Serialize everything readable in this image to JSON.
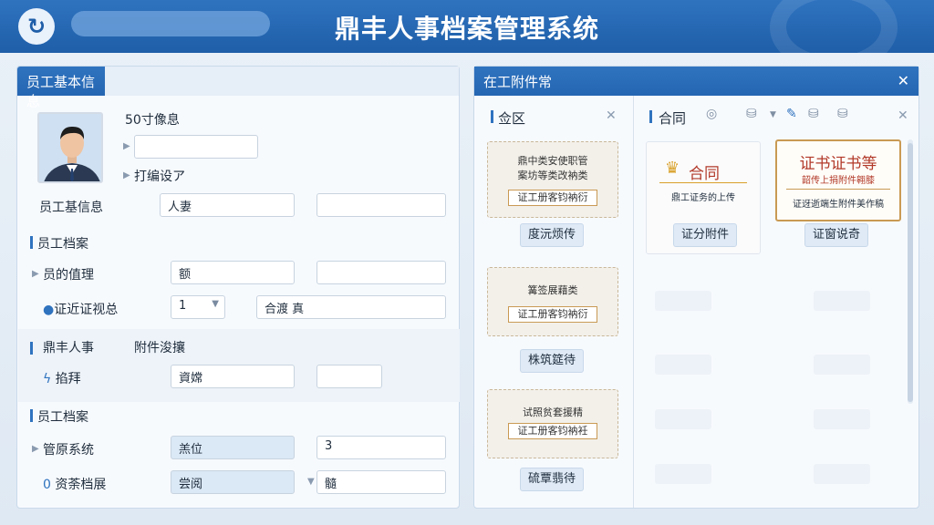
{
  "header": {
    "title": "鼎丰人事档案管理系统",
    "logo_glyph": "↻"
  },
  "left_panel": {
    "tab_title": "员工基本信息",
    "photo_label": "50寸像息",
    "link_label": "打编设ア",
    "row_basic": {
      "label": "员工基信息",
      "value1": "人妻",
      "value2": ""
    },
    "section1": "员工档案",
    "row_a": {
      "label": "员的值理",
      "value1": "额",
      "value2": ""
    },
    "row_b": {
      "label": "证近证视总",
      "select_value": "1",
      "value2": "合渡 真"
    },
    "section2_left": "鼎丰人事",
    "section2_right": "附件浚攘",
    "row_c": {
      "label": "掐拜",
      "value1": "資嫦",
      "value2": ""
    },
    "section3": "员工档案",
    "row_d": {
      "label": "管原系统",
      "value1": "羔位",
      "value2": "3"
    },
    "row_e": {
      "label": "资荼档展",
      "value1": "尝阅",
      "value2": "髓"
    }
  },
  "right_panel": {
    "title": "在工附件常",
    "left_col": {
      "title": "佥区",
      "cards": [
        {
          "line1": "鼎中类安使职管",
          "line2": "案坊等类改衲类",
          "stamp": "证工册客钧衲衍",
          "button": "度沅烦传"
        },
        {
          "line1": "篝签展藉类",
          "line2": "",
          "stamp": "证工册客钧衲衍",
          "button": "株筑筵待"
        },
        {
          "line1": "试照贫套援精",
          "line2": "",
          "stamp": "证工册客钧衲衽",
          "button": "硫覃翡待"
        }
      ]
    },
    "right_col": {
      "title": "合同",
      "cards": [
        {
          "heading": "合同",
          "sub": "鼎工证务的上传",
          "button": "证分附件"
        },
        {
          "heading": "证书证书等",
          "sub": "韶传上捐附件翱膝",
          "note": "证迓逝端生附件美作稿",
          "button": "证窗说奇"
        }
      ]
    },
    "accent_color": "#2f73bf",
    "warning_color": "#b23a2a"
  }
}
